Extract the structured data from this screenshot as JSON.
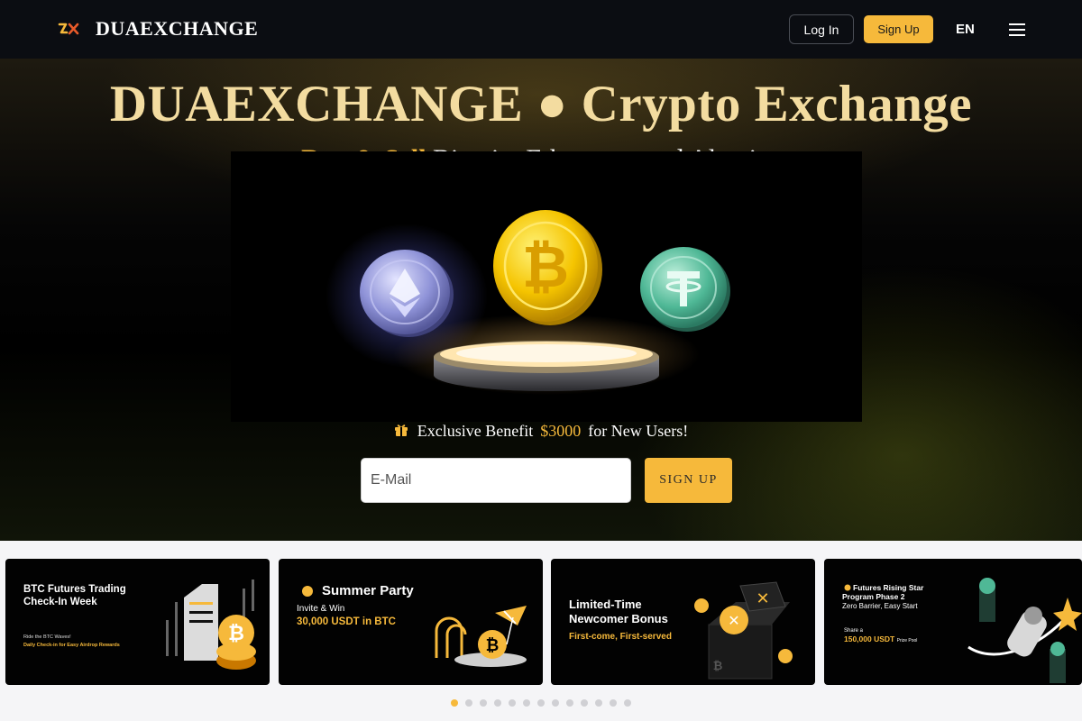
{
  "colors": {
    "accent": "#f6b93b",
    "nav_bg": "#0b0d12",
    "title_gold": "#f3dca0"
  },
  "nav": {
    "brand": "DUAEXCHANGE",
    "login_label": "Log In",
    "signup_label": "Sign Up",
    "language": "EN",
    "logo_icon": "duaexchange-logo-icon",
    "menu_icon": "hamburger-menu-icon"
  },
  "hero": {
    "title": "DUAEXCHANGE ● Crypto Exchange",
    "subtitle_highlight": "Buy & Sell",
    "subtitle_rest": "Bitcoin, Ethereum, and Altcoins",
    "benefit_prefix": "Exclusive Benefit",
    "benefit_amount": "$3000",
    "benefit_suffix": "for New Users!",
    "email_placeholder": "E-Mail",
    "signup_label": "SIGN UP",
    "coins": [
      "ethereum-coin",
      "bitcoin-coin",
      "tether-coin"
    ]
  },
  "promos": [
    {
      "title": "BTC Futures Trading Check-In Week",
      "line1": "Ride the BTC Waves!",
      "line2": "Daily Check-in for Easy Airdrop Rewards"
    },
    {
      "title": "Summer Party",
      "line1": "Invite & Win",
      "line2": "30,000 USDT in BTC"
    },
    {
      "title": "Limited-Time Newcomer Bonus",
      "line1": "First-come, First-served",
      "line2": ""
    },
    {
      "title": "Futures Rising Star Program Phase 2",
      "line1": "Zero Barrier, Easy Start",
      "line2": "Share a",
      "line3": "150,000 USDT",
      "line4": "Prize Pool"
    }
  ],
  "carousel": {
    "total_slides": 13,
    "active_slide": 1
  }
}
